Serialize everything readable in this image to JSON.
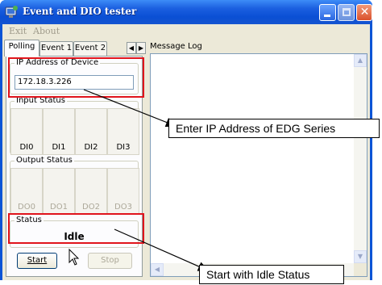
{
  "window": {
    "title": "Event and DIO tester",
    "colors": {
      "titlebar": "#0a54d6",
      "highlight": "#e0141c",
      "face": "#ece9d8"
    }
  },
  "menu": {
    "items": [
      "Exit",
      "About"
    ]
  },
  "tabs": [
    "Polling",
    "Event 1",
    "Event 2"
  ],
  "ip_group": {
    "label": "IP Address of Device",
    "value": "172.18.3.226"
  },
  "input_status": {
    "label": "Input Status",
    "items": [
      "DI0",
      "DI1",
      "DI2",
      "DI3"
    ]
  },
  "output_status": {
    "label": "Output Status",
    "items": [
      "DO0",
      "DO1",
      "DO2",
      "DO3"
    ]
  },
  "status": {
    "label": "Status",
    "value": "Idle"
  },
  "buttons": {
    "start": "Start",
    "stop": "Stop"
  },
  "message_log": {
    "label": "Message Log"
  },
  "callouts": {
    "ip": "Enter IP Address of EDG Series",
    "status": "Start with Idle Status"
  }
}
